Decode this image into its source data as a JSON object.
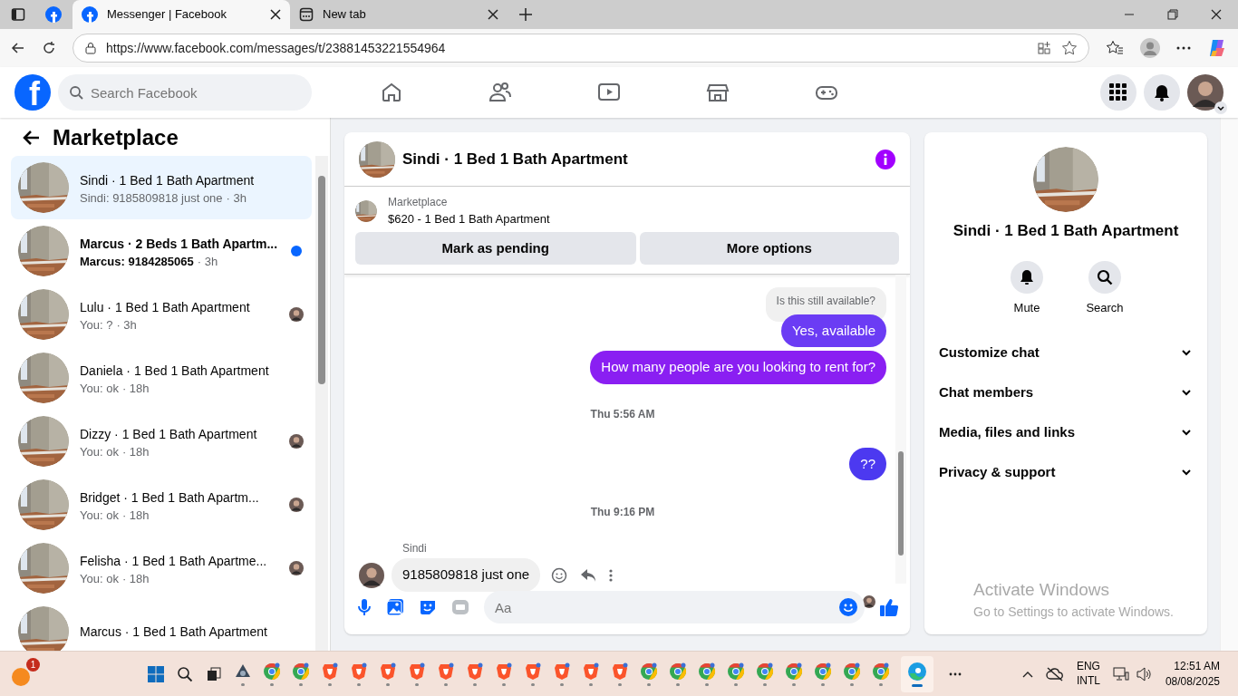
{
  "browser": {
    "tabs": [
      {
        "kind": "facebook",
        "title": "Messenger | Facebook",
        "selected": true
      },
      {
        "kind": "newtab",
        "title": "New tab",
        "selected": false
      }
    ],
    "address": "https://www.facebook.com/messages/t/23881453221554964"
  },
  "topbar": {
    "logo": "f",
    "search_placeholder": "Search Facebook",
    "nav": [
      {
        "kind": "home",
        "selected": false
      },
      {
        "kind": "friends",
        "selected": false
      },
      {
        "kind": "watch",
        "selected": false
      },
      {
        "kind": "marketplace",
        "selected": false
      },
      {
        "kind": "gaming",
        "selected": false
      }
    ]
  },
  "sidebar": {
    "title": "Marketplace",
    "conversations": [
      {
        "title": "Sindi · 1 Bed 1 Bath Apartment",
        "preview": "Sindi: 9185809818 just one",
        "time": "· 3h",
        "selected": true,
        "unread": false,
        "seen": false
      },
      {
        "title": "Marcus · 2 Beds 1 Bath Apartm...",
        "preview": "Marcus: 9184285065",
        "time": "· 3h",
        "selected": false,
        "unread": true,
        "seen": false
      },
      {
        "title": "Lulu · 1 Bed 1 Bath Apartment",
        "preview": "You: ?",
        "time": "· 3h",
        "selected": false,
        "unread": false,
        "seen": true
      },
      {
        "title": "Daniela · 1 Bed 1 Bath Apartment",
        "preview": "You: ok",
        "time": "· 18h",
        "selected": false,
        "unread": false,
        "seen": false
      },
      {
        "title": "Dizzy · 1 Bed 1 Bath Apartment",
        "preview": "You: ok",
        "time": "· 18h",
        "selected": false,
        "unread": false,
        "seen": true
      },
      {
        "title": "Bridget · 1 Bed 1 Bath Apartm...",
        "preview": "You: ok",
        "time": "· 18h",
        "selected": false,
        "unread": false,
        "seen": true
      },
      {
        "title": "Felisha · 1 Bed 1 Bath Apartme...",
        "preview": "You: ok",
        "time": "· 18h",
        "selected": false,
        "unread": false,
        "seen": true
      },
      {
        "title": "Marcus · 1 Bed 1 Bath Apartment",
        "selected": false
      }
    ]
  },
  "chat": {
    "title": "Sindi · 1 Bed 1 Bath Apartment",
    "listing_label": "Marketplace",
    "listing": "$620 - 1 Bed 1 Bath Apartment",
    "buttons": [
      "Mark as pending",
      "More options"
    ],
    "messages": [
      {
        "kind": "quote",
        "text": "Is this still available?"
      },
      {
        "kind": "sent",
        "text": "Yes, available",
        "color": "#6b3cf4"
      },
      {
        "kind": "sent",
        "text": "How many people are you looking to rent for?",
        "color": "#8a1ff2"
      },
      {
        "kind": "time",
        "text": "Thu 5:56 AM"
      },
      {
        "kind": "sent",
        "text": "??",
        "color": "#4c39f0"
      },
      {
        "kind": "time",
        "text": "Thu 9:16 PM"
      },
      {
        "kind": "sender",
        "text": "Sindi"
      },
      {
        "kind": "received",
        "text": "9185809818 just one"
      }
    ],
    "composer_placeholder": "Aa"
  },
  "info": {
    "title": "Sindi · 1 Bed 1 Bath Apartment",
    "actions": [
      {
        "kind": "bell",
        "label": "Mute"
      },
      {
        "kind": "search",
        "label": "Search"
      }
    ],
    "sections": [
      {
        "label": "Customize chat",
        "expanded": false
      },
      {
        "label": "Chat members",
        "expanded": false
      },
      {
        "label": "Media, files and links",
        "expanded": false
      },
      {
        "label": "Privacy & support",
        "expanded": false
      }
    ],
    "activation_title": "Activate Windows",
    "activation_text": "Go to Settings to activate Windows."
  },
  "taskbar": {
    "badge": "1",
    "apps": [
      {
        "kind": "app"
      },
      {
        "kind": "chrome"
      },
      {
        "kind": "chrome"
      },
      {
        "kind": "brave"
      },
      {
        "kind": "brave"
      },
      {
        "kind": "brave"
      },
      {
        "kind": "brave"
      },
      {
        "kind": "brave"
      },
      {
        "kind": "brave"
      },
      {
        "kind": "brave"
      },
      {
        "kind": "brave"
      },
      {
        "kind": "brave"
      },
      {
        "kind": "brave"
      },
      {
        "kind": "brave"
      },
      {
        "kind": "chrome"
      },
      {
        "kind": "chrome"
      },
      {
        "kind": "chrome"
      },
      {
        "kind": "chrome"
      },
      {
        "kind": "chrome"
      },
      {
        "kind": "chrome"
      },
      {
        "kind": "chrome"
      },
      {
        "kind": "chrome"
      },
      {
        "kind": "chrome"
      },
      {
        "kind": "edge",
        "selected": true
      }
    ],
    "lang": "ENG",
    "layout": "INTL",
    "time": "12:51 AM",
    "date": "08/08/2025"
  }
}
